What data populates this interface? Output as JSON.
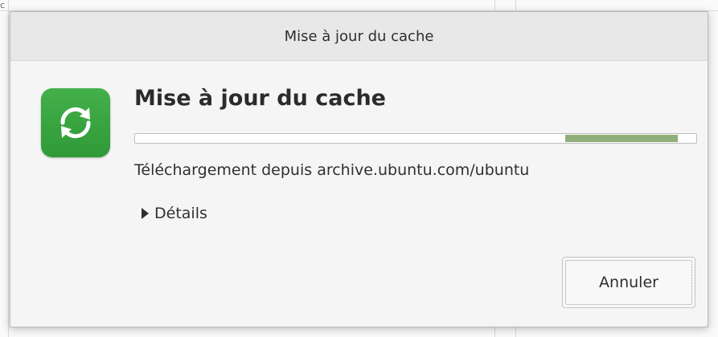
{
  "background": {
    "corner_glyph": "c"
  },
  "dialog": {
    "title": "Mise à jour du cache",
    "heading": "Mise à jour du cache",
    "icon": "refresh-icon",
    "accent_color": "#3aa642",
    "progress": {
      "start": 0.767,
      "end": 0.967,
      "fill_color": "#8fb07a"
    },
    "status": "Téléchargement depuis archive.ubuntu.com/ubuntu",
    "details_label": "Détails",
    "cancel_label": "Annuler"
  }
}
